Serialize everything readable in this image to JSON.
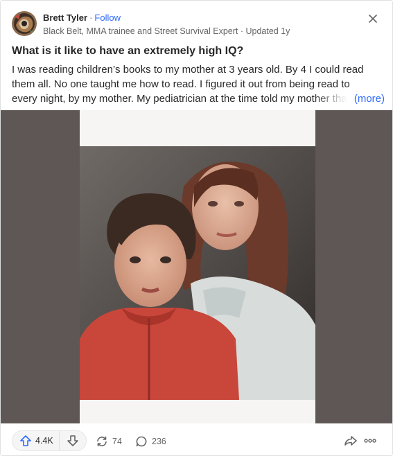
{
  "author": {
    "name": "Brett Tyler",
    "separator": "·",
    "follow_label": "Follow",
    "credential": "Black Belt, MMA trainee and Street Survival Expert · Updated 1y",
    "avatar_icon": "profile-avatar"
  },
  "close_icon": "close-icon",
  "question": "What is it like to have an extremely high IQ?",
  "answer": {
    "line1": "I was reading children’s books to my mother at 3 years old. By 4 I could read",
    "line2": "them all. No one taught me how to read. I figured it out from being read to",
    "line3": "every night, by my mother. My pediatrician at the time told my mother tha",
    "more_label": "(more)"
  },
  "media": {
    "description_icon": "old-photo"
  },
  "actions": {
    "upvote_count": "4.4K",
    "reshare_count": "74",
    "comment_count": "236"
  },
  "colors": {
    "accent": "#2e69ff",
    "text": "#282829",
    "muted": "#636466",
    "media_bg": "#5e5756"
  }
}
